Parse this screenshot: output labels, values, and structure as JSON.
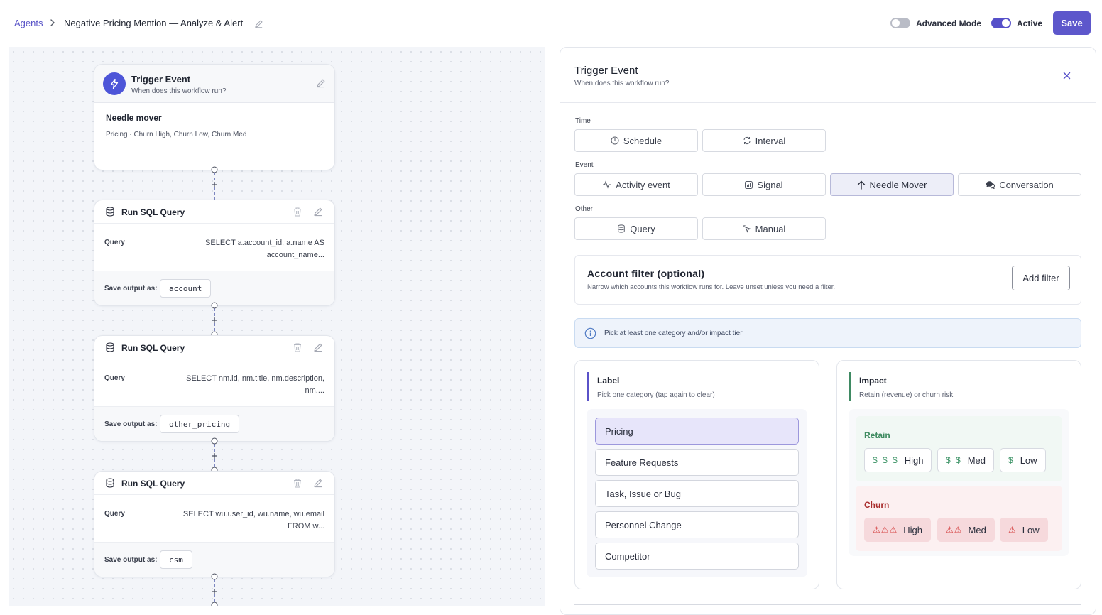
{
  "breadcrumb": {
    "root": "Agents",
    "title": "Negative Pricing Mention — Analyze & Alert"
  },
  "header": {
    "advanced_mode_label": "Advanced Mode",
    "advanced_mode_on": false,
    "active_label": "Active",
    "active_on": true,
    "save_label": "Save"
  },
  "canvas": {
    "trigger_node": {
      "title": "Trigger Event",
      "subtitle": "When does this workflow run?",
      "body_title": "Needle mover",
      "body_sub": "Pricing · Churn High, Churn Low, Churn Med"
    },
    "sql_nodes": [
      {
        "title": "Run SQL Query",
        "query_label": "Query",
        "query": "SELECT a.account_id, a.name AS account_name...",
        "output_label": "Save output as:",
        "output": "account"
      },
      {
        "title": "Run SQL Query",
        "query_label": "Query",
        "query": "SELECT nm.id, nm.title, nm.description, nm....",
        "output_label": "Save output as:",
        "output": "other_pricing"
      },
      {
        "title": "Run SQL Query",
        "query_label": "Query",
        "query": "SELECT wu.user_id, wu.name, wu.email FROM w...",
        "output_label": "Save output as:",
        "output": "csm"
      }
    ]
  },
  "panel": {
    "title": "Trigger Event",
    "subtitle": "When does this workflow run?",
    "groups": {
      "time": {
        "label": "Time",
        "options": [
          {
            "label": "Schedule",
            "icon": "clock-icon"
          },
          {
            "label": "Interval",
            "icon": "repeat-icon"
          }
        ]
      },
      "event": {
        "label": "Event",
        "options": [
          {
            "label": "Activity event",
            "icon": "activity-icon"
          },
          {
            "label": "Signal",
            "icon": "signal-icon"
          },
          {
            "label": "Needle Mover",
            "icon": "arrow-up-icon",
            "selected": true
          },
          {
            "label": "Conversation",
            "icon": "chat-icon"
          }
        ]
      },
      "other": {
        "label": "Other",
        "options": [
          {
            "label": "Query",
            "icon": "database-icon"
          },
          {
            "label": "Manual",
            "icon": "cursor-click-icon"
          }
        ]
      }
    },
    "account_filter": {
      "title": "Account filter (optional)",
      "subtitle": "Narrow which accounts this workflow runs for. Leave unset unless you need a filter.",
      "button": "Add filter"
    },
    "info": "Pick at least one category and/or impact tier",
    "label_card": {
      "title": "Label",
      "subtitle": "Pick one category (tap again to clear)",
      "items": [
        "Pricing",
        "Feature Requests",
        "Task, Issue or Bug",
        "Personnel Change",
        "Competitor"
      ],
      "selected": "Pricing"
    },
    "impact_card": {
      "title": "Impact",
      "subtitle": "Retain (revenue) or churn risk",
      "retain": {
        "title": "Retain",
        "chips": [
          {
            "symbols": "$ $ $",
            "label": "High"
          },
          {
            "symbols": "$ $",
            "label": "Med"
          },
          {
            "symbols": "$",
            "label": "Low"
          }
        ]
      },
      "churn": {
        "title": "Churn",
        "chips": [
          {
            "symbols": "⚠⚠⚠",
            "label": "High"
          },
          {
            "symbols": "⚠⚠",
            "label": "Med"
          },
          {
            "symbols": "⚠",
            "label": "Low"
          }
        ]
      }
    }
  },
  "colors": {
    "accent": "#5d57cb",
    "retain": "#3d9467",
    "churn": "#b12e2e",
    "label_accent": "#5a52c8",
    "impact_accent": "#3f8a63"
  }
}
